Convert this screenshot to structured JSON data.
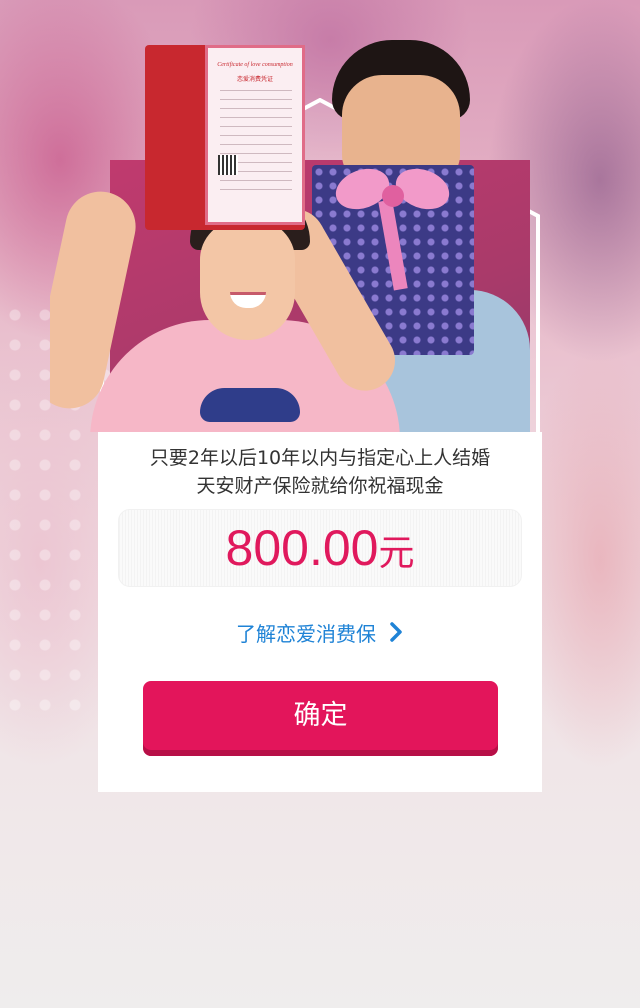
{
  "hero": {
    "certificate_title": "Certificate of love consumption",
    "certificate_subtitle": "恋爱消费凭证"
  },
  "card": {
    "description_line1": "只要2年以后10年以内与指定心上人结婚",
    "description_line2": "天安财产保险就给你祝福现金",
    "amount_value": "800.00",
    "amount_unit": "元",
    "learn_more_label": "了解恋爱消费保",
    "confirm_label": "确定"
  },
  "icons": {
    "learn_more_icon": "chevron-right-icon"
  },
  "colors": {
    "accent": "#e3155b",
    "amount": "#e0195d",
    "link": "#1f83d6"
  }
}
